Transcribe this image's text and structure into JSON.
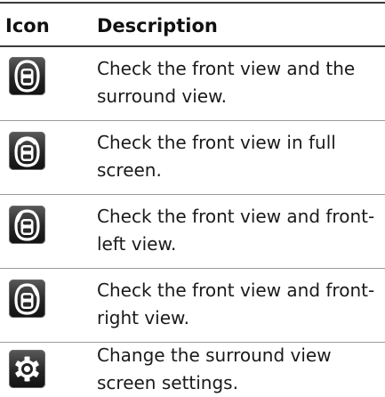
{
  "header": {
    "icon_col": "Icon",
    "desc_col": "Description"
  },
  "rows": [
    {
      "icon": "car-front-surround-view-icon",
      "description": "Check the front view and the surround view."
    },
    {
      "icon": "car-front-full-screen-view-icon",
      "description": "Check the front view in full screen."
    },
    {
      "icon": "car-front-left-view-icon",
      "description": "Check the front view and front-left view."
    },
    {
      "icon": "car-front-right-view-icon",
      "description": "Check the front view and front-right view."
    },
    {
      "icon": "gear-settings-icon",
      "description": "Change the surround view screen settings."
    }
  ]
}
